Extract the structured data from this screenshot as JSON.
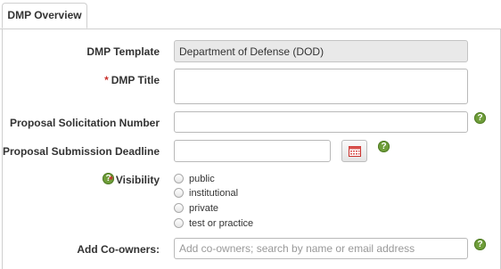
{
  "tabs": [
    {
      "label": "DMP Overview"
    }
  ],
  "form": {
    "template": {
      "label": "DMP Template",
      "value": "Department of Defense (DOD)"
    },
    "title": {
      "required_mark": "*",
      "label": "DMP Title",
      "value": ""
    },
    "solicitation": {
      "label": "Proposal Solicitation Number",
      "value": ""
    },
    "deadline": {
      "label": "Proposal Submission Deadline",
      "value": ""
    },
    "visibility": {
      "required_mark": "*",
      "label": "Visibility",
      "options": [
        "public",
        "institutional",
        "private",
        "test or practice"
      ]
    },
    "coowners": {
      "label": "Add Co-owners:",
      "placeholder": "Add co-owners; search by name or email address"
    }
  },
  "help_glyph": "?",
  "icons": {
    "help": "help-icon",
    "calendar": "calendar-icon"
  },
  "colors": {
    "help_green": "#6f9e3a",
    "required_red": "#c9302c",
    "calendar_red": "#d9534f"
  }
}
